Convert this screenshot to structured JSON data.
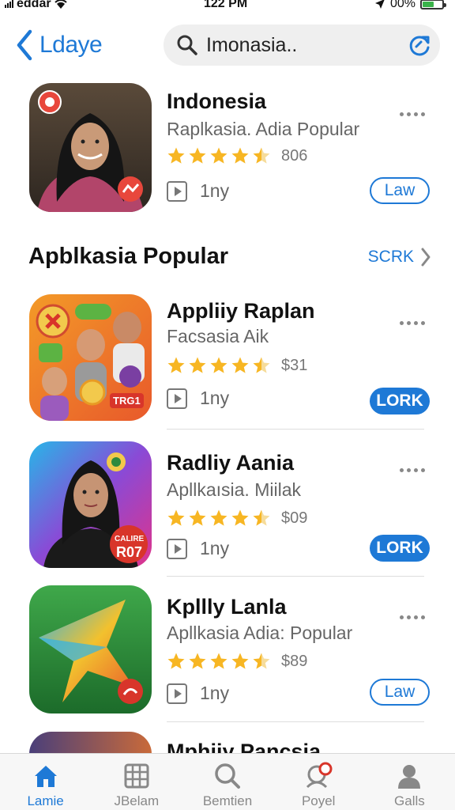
{
  "status_bar": {
    "carrier": "eddar",
    "time": "122 PM",
    "battery": "00%",
    "battery_level": 0.6
  },
  "nav": {
    "back_label": "Ldaye",
    "search_text": "Imonasia.."
  },
  "featured": {
    "title": "Indonesia",
    "subtitle": "Raplkasia. Adia Popular",
    "rating": 4.5,
    "price": "806",
    "meta": "1ny",
    "action": "Law"
  },
  "section": {
    "title": "Apblkasia Popular",
    "see_all": "SCRK"
  },
  "apps": [
    {
      "title": "Appliiy Raplan",
      "subtitle": "Facsasia Aik",
      "rating": 4.5,
      "price": "$31",
      "meta": "1ny",
      "action": "LORK",
      "icon_badge": "TRG1"
    },
    {
      "title": "Radliy Aania",
      "subtitle": "Apllkaısia. Miilak",
      "rating": 4.5,
      "price": "$09",
      "meta": "1ny",
      "action": "LORK",
      "icon_badge_top": "CALIRE",
      "icon_badge": "R07"
    },
    {
      "title": "Kpllly Lanla",
      "subtitle": "Apllkasia Adia: Popular",
      "rating": 4.5,
      "price": "$89",
      "meta": "1ny",
      "action": "Law"
    },
    {
      "title": "Mphiiy Pancsia"
    }
  ],
  "tabs": [
    {
      "label": "Lamie",
      "icon": "home-icon",
      "active": true
    },
    {
      "label": "JBelam",
      "icon": "grid-icon",
      "active": false
    },
    {
      "label": "Bemtien",
      "icon": "search-icon",
      "active": false
    },
    {
      "label": "Poyel",
      "icon": "user-badge-icon",
      "active": false
    },
    {
      "label": "Galls",
      "icon": "person-icon",
      "active": false
    }
  ],
  "colors": {
    "accent": "#1e79d6",
    "star": "#f7b623",
    "battery": "#3ab34a"
  }
}
